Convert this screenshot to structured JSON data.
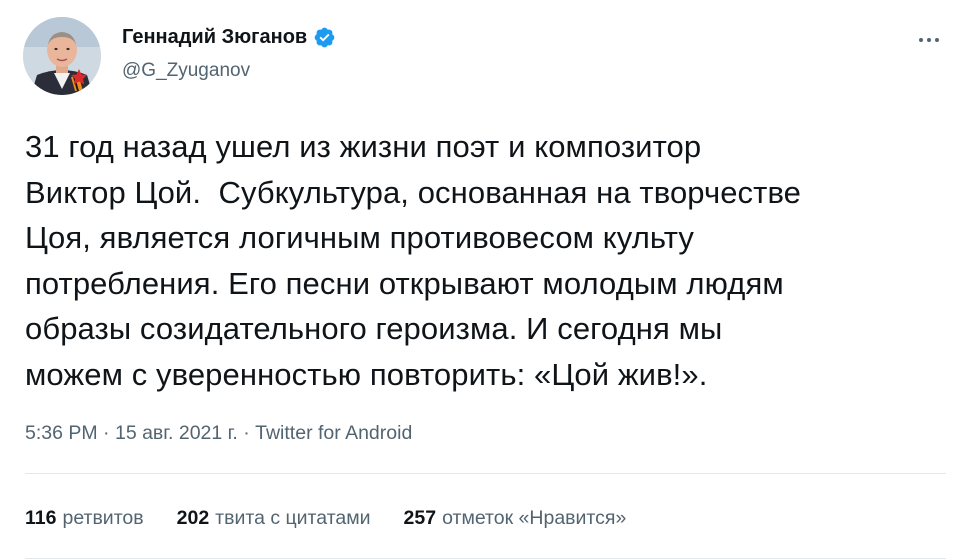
{
  "author": {
    "name": "Геннадий Зюганов",
    "handle": "@G_Zyuganov",
    "verified": true,
    "avatar_icon": "profile-photo"
  },
  "more_icon": "more-horizontal-icon",
  "tweet": {
    "text": "31 год назад ушел из жизни поэт и композитор\nВиктор Цой.  Субкультура, основанная на творчестве\nЦоя, является логичным противовесом культу\nпотребления. Его песни открывают молодым людям\nобразы созидательного героизма. И сегодня мы\nможем с уверенностью повторить: «Цой жив!».",
    "time": "5:36 PM",
    "date": "15 авг. 2021 г.",
    "source": "Twitter for Android",
    "separator": "·"
  },
  "stats": {
    "retweets_count": "116",
    "retweets_label": "ретвитов",
    "quotes_count": "202",
    "quotes_label": "твита с цитатами",
    "likes_count": "257",
    "likes_label": "отметок «Нравится»"
  },
  "colors": {
    "text_primary": "#0f1419",
    "text_secondary": "#536471",
    "verified_blue": "#1d9bf0",
    "divider": "#e3e8ec"
  }
}
